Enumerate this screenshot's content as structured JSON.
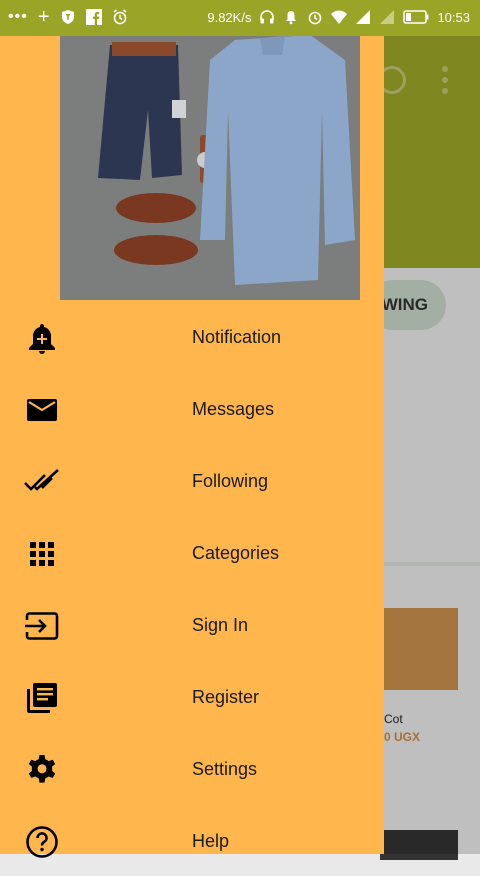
{
  "status_bar": {
    "network_speed": "9.82K/s",
    "time": "10:53"
  },
  "background": {
    "chip_label": "WING",
    "card_title": "Cot",
    "card_price": "0 UGX"
  },
  "drawer": {
    "menu": [
      {
        "label": "Notification",
        "icon": "bell-plus-icon"
      },
      {
        "label": "Messages",
        "icon": "envelope-icon"
      },
      {
        "label": "Following",
        "icon": "double-check-icon"
      },
      {
        "label": "Categories",
        "icon": "grid-icon"
      },
      {
        "label": "Sign In",
        "icon": "sign-in-icon"
      },
      {
        "label": "Register",
        "icon": "library-books-icon"
      },
      {
        "label": "Settings",
        "icon": "gear-icon"
      },
      {
        "label": "Help",
        "icon": "help-icon"
      }
    ]
  },
  "colors": {
    "drawer_bg": "#ffb74d",
    "appbar_bg": "#9aa528"
  }
}
